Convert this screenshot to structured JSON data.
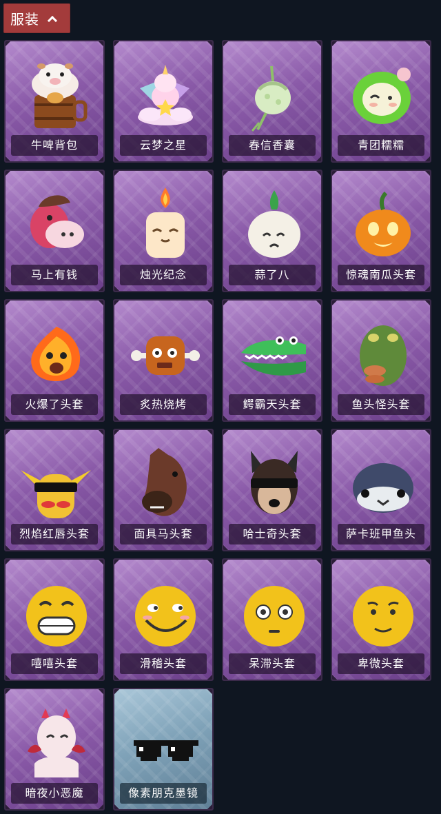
{
  "section": {
    "title": "服装"
  },
  "items": [
    {
      "label": "牛啤背包",
      "icon": "cow-beer-backpack"
    },
    {
      "label": "云梦之星",
      "icon": "unicorn-cloud-star"
    },
    {
      "label": "春信香囊",
      "icon": "sachet-pouch"
    },
    {
      "label": "青团糯糯",
      "icon": "green-dumpling"
    },
    {
      "label": "马上有钱",
      "icon": "red-horse-head"
    },
    {
      "label": "烛光纪念",
      "icon": "candle"
    },
    {
      "label": "蒜了八",
      "icon": "garlic"
    },
    {
      "label": "惊魂南瓜头套",
      "icon": "pumpkin-head"
    },
    {
      "label": "火爆了头套",
      "icon": "fireball-head"
    },
    {
      "label": "炙热烧烤",
      "icon": "grilled-meat"
    },
    {
      "label": "鳄霸天头套",
      "icon": "crocodile-head"
    },
    {
      "label": "鱼头怪头套",
      "icon": "fish-monster-head"
    },
    {
      "label": "烈焰红唇头套",
      "icon": "yellow-hood-sunglasses"
    },
    {
      "label": "面具马头套",
      "icon": "horse-mask"
    },
    {
      "label": "哈士奇头套",
      "icon": "husky-head"
    },
    {
      "label": "萨卡班甲鱼头",
      "icon": "sacabambaspis-head"
    },
    {
      "label": "嘻嘻头套",
      "icon": "grinning-emoji"
    },
    {
      "label": "滑稽头套",
      "icon": "funny-emoji"
    },
    {
      "label": "呆滞头套",
      "icon": "dazed-emoji"
    },
    {
      "label": "卑微头套",
      "icon": "humble-emoji"
    },
    {
      "label": "暗夜小恶魔",
      "icon": "little-devil"
    },
    {
      "label": "像素朋克墨镜",
      "icon": "pixel-sunglasses"
    }
  ]
}
